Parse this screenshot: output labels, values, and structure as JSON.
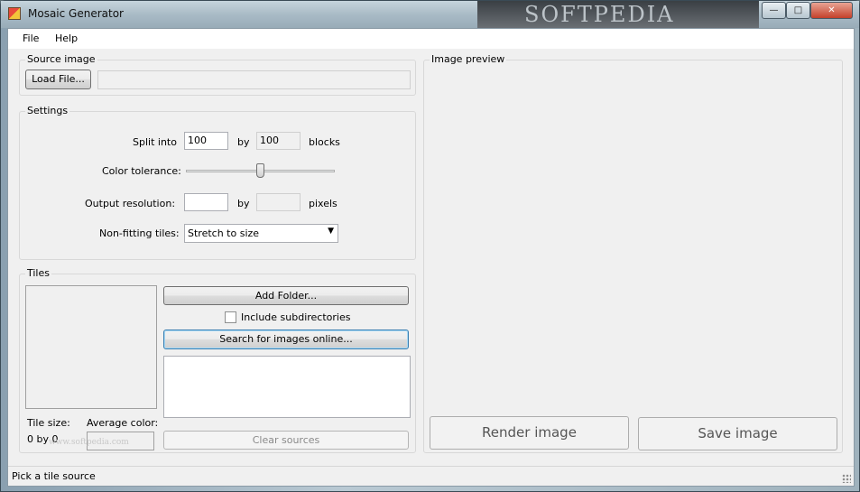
{
  "window": {
    "title": "Mosaic Generator",
    "watermark": "SOFTPEDIA",
    "buttons": {
      "minimize": "—",
      "maximize": "□",
      "close": "✕"
    }
  },
  "menu": {
    "file": "File",
    "help": "Help"
  },
  "source_image": {
    "group_label": "Source image",
    "load_button": "Load File...",
    "path_value": ""
  },
  "settings": {
    "group_label": "Settings",
    "split_label": "Split into",
    "split_x": "100",
    "split_by": "by",
    "split_y": "100",
    "blocks_label": "blocks",
    "tolerance_label": "Color tolerance:",
    "tolerance_level": 0.5,
    "output_label": "Output resolution:",
    "output_w": "",
    "output_by": "by",
    "output_h": "",
    "pixels_label": "pixels",
    "nonfit_label": "Non-fitting tiles:",
    "nonfit_value": "Stretch to size"
  },
  "tiles": {
    "group_label": "Tiles",
    "tile_size_label": "Tile size:",
    "tile_size_value": "0 by 0",
    "avg_color_label": "Average color:",
    "add_folder_button": "Add Folder...",
    "include_subdirs_label": "Include subdirectories",
    "include_subdirs_checked": false,
    "search_online_button": "Search for images online...",
    "clear_sources_button": "Clear sources",
    "watermark": "www.softpedia.com"
  },
  "preview": {
    "group_label": "Image preview",
    "render_button": "Render image",
    "save_button": "Save image"
  },
  "status": {
    "text": "Pick a tile source"
  }
}
